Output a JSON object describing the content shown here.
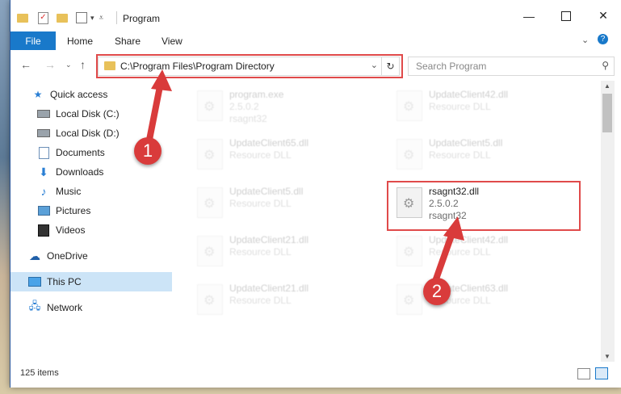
{
  "window": {
    "title": "Program"
  },
  "ribbon": {
    "file_label": "File",
    "tabs": [
      "Home",
      "Share",
      "View"
    ]
  },
  "address": {
    "path": "C:\\Program Files\\Program Directory"
  },
  "search": {
    "placeholder": "Search Program"
  },
  "sidebar": {
    "items": [
      {
        "label": "Quick access",
        "icon": "star-icon",
        "pinned": false
      },
      {
        "label": "Local Disk (C:)",
        "icon": "drive-icon",
        "pinned": true
      },
      {
        "label": "Local Disk (D:)",
        "icon": "drive-icon",
        "pinned": true
      },
      {
        "label": "Documents",
        "icon": "documents-icon",
        "pinned": true
      },
      {
        "label": "Downloads",
        "icon": "download-icon",
        "pinned": true
      },
      {
        "label": "Music",
        "icon": "music-icon",
        "pinned": true
      },
      {
        "label": "Pictures",
        "icon": "pictures-icon",
        "pinned": true
      },
      {
        "label": "Videos",
        "icon": "videos-icon",
        "pinned": true
      },
      {
        "label": "OneDrive",
        "icon": "cloud-icon",
        "pinned": false
      },
      {
        "label": "This PC",
        "icon": "pc-icon",
        "pinned": false
      },
      {
        "label": "Network",
        "icon": "network-icon",
        "pinned": false
      }
    ]
  },
  "files": [
    {
      "name": "program.exe",
      "line2": "2.5.0.2",
      "line3": "rsagnt32"
    },
    {
      "name": "UpdateClient42.dll",
      "line2": "Resource DLL",
      "line3": ""
    },
    {
      "name": "UpdateClient65.dll",
      "line2": "Resource DLL",
      "line3": ""
    },
    {
      "name": "UpdateClient5.dll",
      "line2": "Resource DLL",
      "line3": ""
    },
    {
      "name": "UpdateClient5.dll",
      "line2": "Resource DLL",
      "line3": ""
    },
    {
      "name": "rsagnt32.dll",
      "line2": "2.5.0.2",
      "line3": "rsagnt32"
    },
    {
      "name": "UpdateClient21.dll",
      "line2": "Resource DLL",
      "line3": ""
    },
    {
      "name": "UpdateClient42.dll",
      "line2": "Resource DLL",
      "line3": ""
    },
    {
      "name": "UpdateClient21.dll",
      "line2": "Resource DLL",
      "line3": ""
    },
    {
      "name": "UpdateClient63.dll",
      "line2": "Resource DLL",
      "line3": ""
    }
  ],
  "status": {
    "item_count": "125 items"
  },
  "annotations": {
    "step1": "1",
    "step2": "2"
  },
  "colors": {
    "accent": "#1979ca",
    "highlight_box": "#e04a4a",
    "badge": "#d93b3b"
  }
}
